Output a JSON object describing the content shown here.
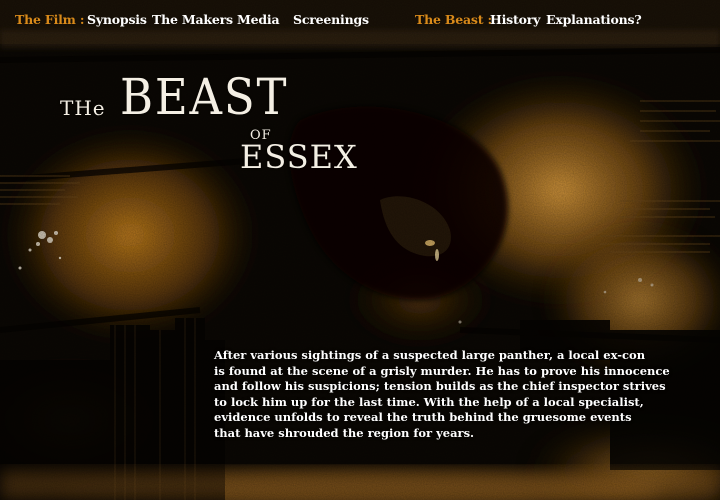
{
  "nav": {
    "film_label": "The Film :",
    "synopsis": "Synopsis",
    "makers": "The Makers",
    "media": "Media",
    "screenings": "Screenings",
    "beast_label": "The Beast :",
    "history": "History",
    "explanations": "Explanations?"
  },
  "title": {
    "the": "THe",
    "beast": "BEAST",
    "of": "OF",
    "essex": "ESSEX"
  },
  "synopsis": {
    "lines": [
      "After various sightings of a suspected large panther, a local ex-con",
      "is found at the scene of a grisly murder. He has to prove his innocence",
      "and follow his suspicions; tension builds as the chief inspector strives",
      "to lock him up for the last time. With the help of a local specialist,",
      "evidence unfolds to reveal the truth behind the gruesome events",
      "that have shrouded the region for years."
    ]
  },
  "colors": {
    "background": "#0c0904",
    "accent_orange": "#d98a1a",
    "text": "#ffffff"
  }
}
